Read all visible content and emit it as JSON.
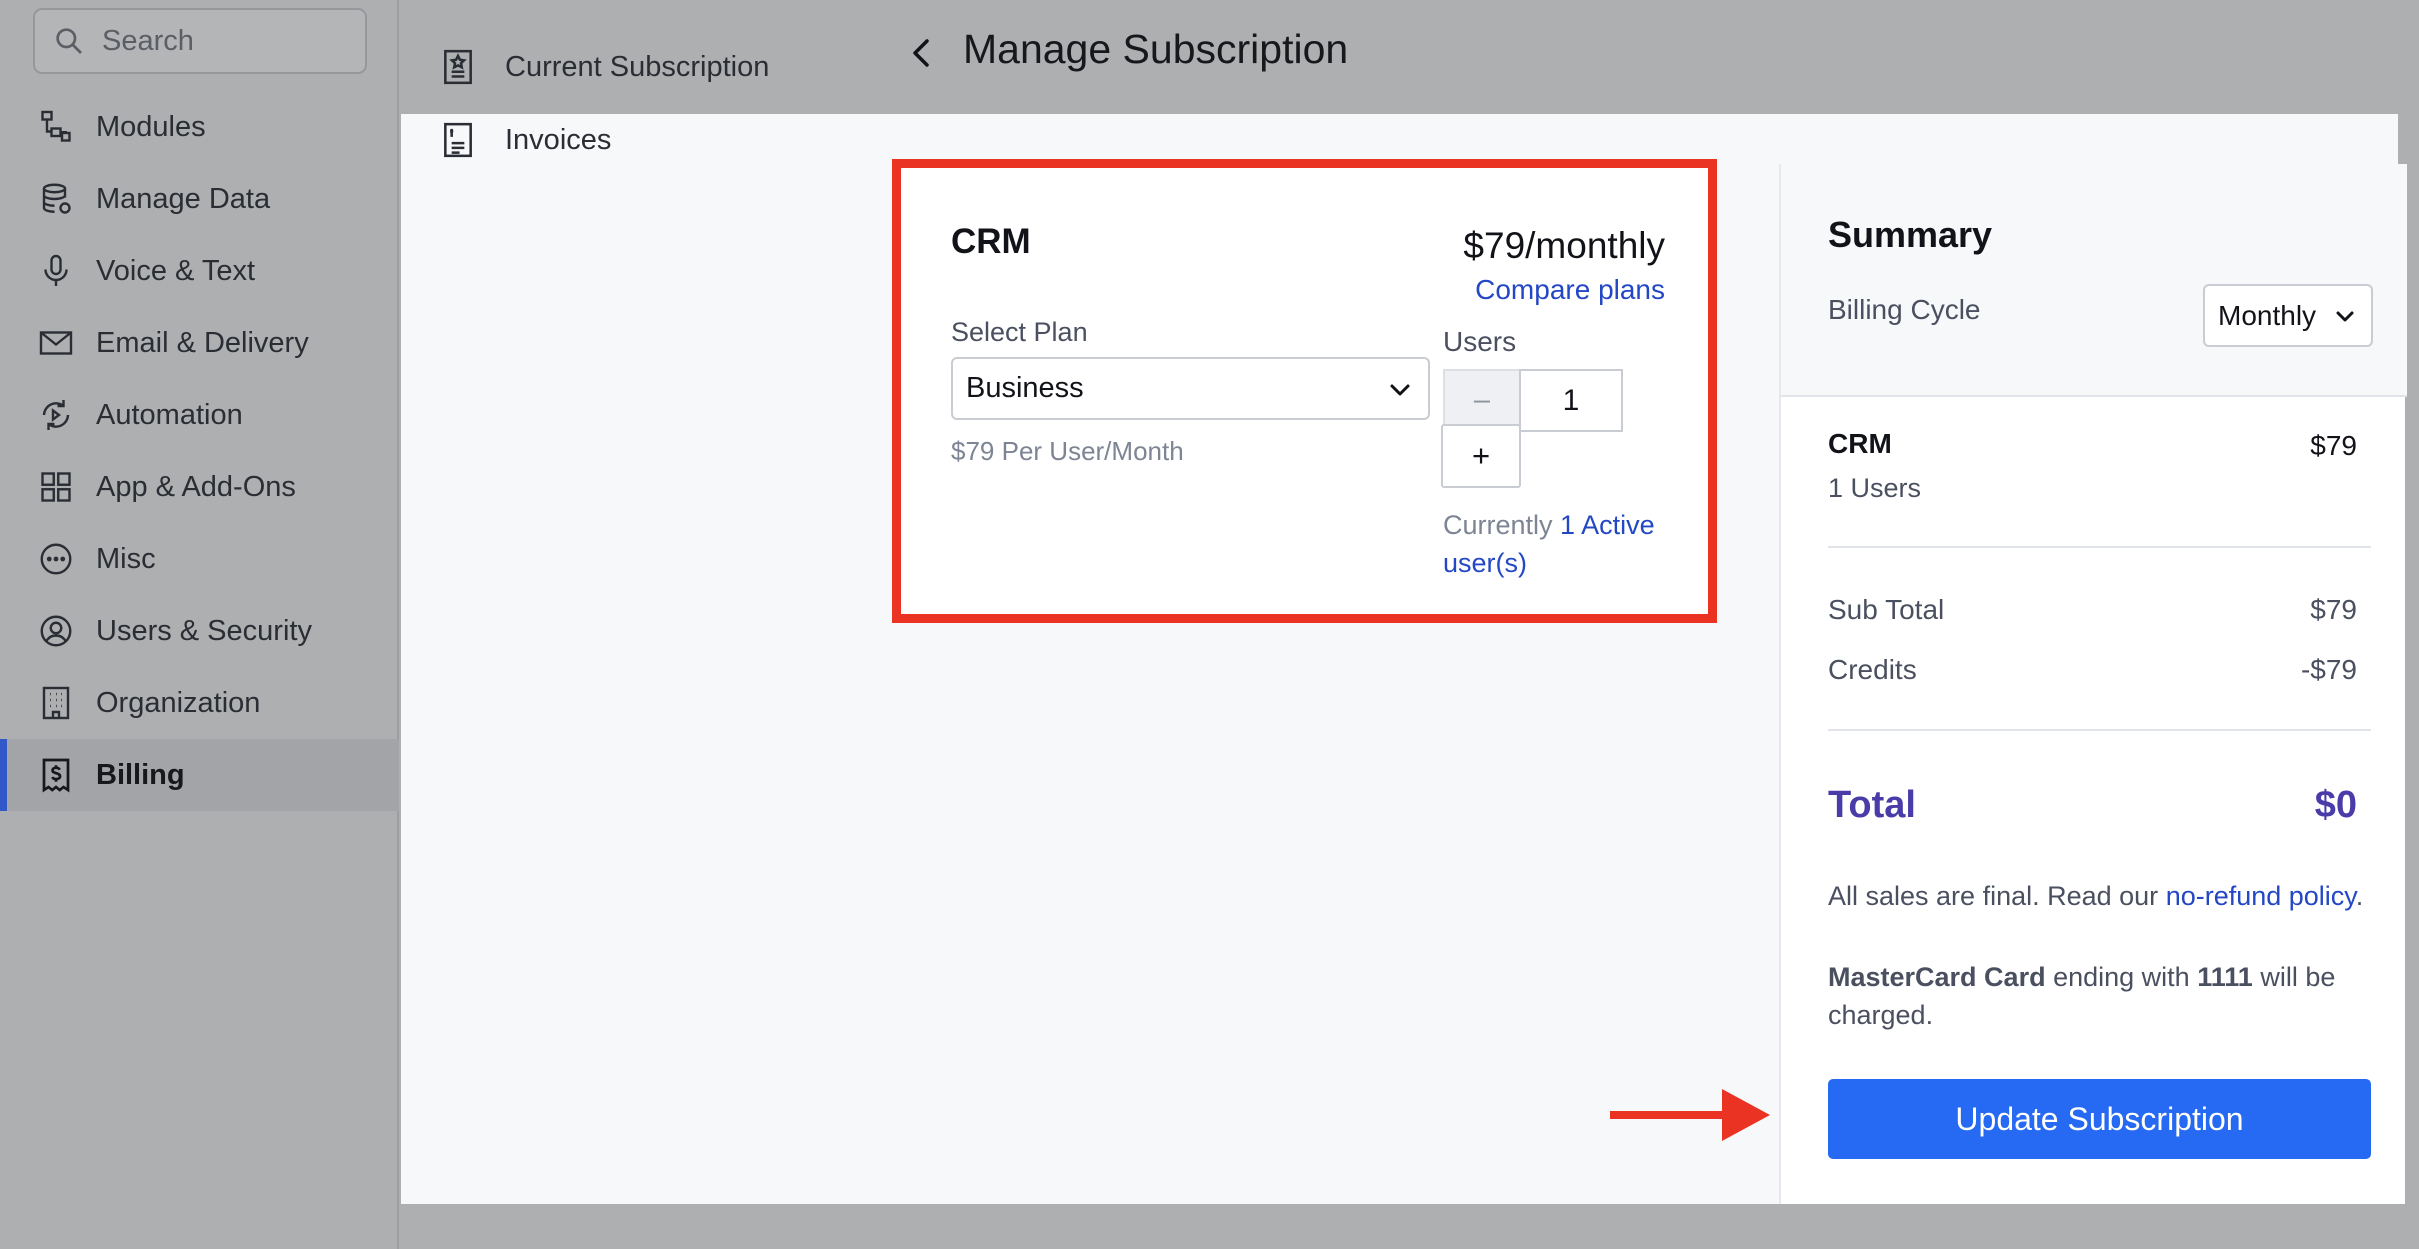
{
  "sidebar": {
    "search_placeholder": "Search",
    "items": [
      {
        "label": "Modules",
        "icon": "modules-icon"
      },
      {
        "label": "Manage Data",
        "icon": "database-icon"
      },
      {
        "label": "Voice & Text",
        "icon": "microphone-icon"
      },
      {
        "label": "Email & Delivery",
        "icon": "envelope-icon"
      },
      {
        "label": "Automation",
        "icon": "automation-icon"
      },
      {
        "label": "App & Add-Ons",
        "icon": "grid-icon"
      },
      {
        "label": "Misc",
        "icon": "ellipsis-circle-icon"
      },
      {
        "label": "Users & Security",
        "icon": "user-circle-icon"
      },
      {
        "label": "Organization",
        "icon": "building-icon"
      },
      {
        "label": "Billing",
        "icon": "billing-icon",
        "active": true
      }
    ]
  },
  "subnav": {
    "items": [
      {
        "label": "Current Subscription",
        "icon": "subscription-icon"
      },
      {
        "label": "Invoices",
        "icon": "invoice-icon"
      }
    ]
  },
  "header": {
    "title": "Manage Subscription"
  },
  "crm_card": {
    "name": "CRM",
    "price": "$79/monthly",
    "compare_link": "Compare plans",
    "select_plan_label": "Select Plan",
    "selected_plan": "Business",
    "per_user_price": "$79 Per User/Month",
    "users_label": "Users",
    "minus_label": "–",
    "quantity": "1",
    "plus_label": "+",
    "currently_text": "Currently",
    "active_users_link": "1 Active user(s)"
  },
  "summary": {
    "title": "Summary",
    "billing_cycle_label": "Billing Cycle",
    "billing_cycle_value": "Monthly",
    "item_name": "CRM",
    "item_price": "$79",
    "item_users": "1 Users",
    "subtotal_label": "Sub Total",
    "subtotal_value": "$79",
    "credits_label": "Credits",
    "credits_value": "-$79",
    "total_label": "Total",
    "total_value": "$0",
    "final_text": "All sales are final. Read our",
    "refund_link": "no-refund policy",
    "final_period": ".",
    "card_brand": "MasterCard Card",
    "card_mid": "ending with",
    "card_last4": "1111",
    "card_tail": "will be charged.",
    "update_button": "Update Subscription"
  },
  "colors": {
    "highlight": "#ea3323",
    "primary_button": "#2669f2",
    "total_text": "#4a3ca8",
    "link": "#2347c5"
  }
}
